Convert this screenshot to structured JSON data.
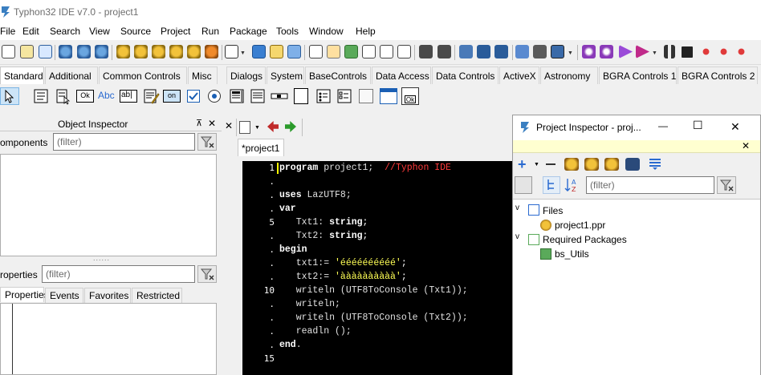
{
  "window": {
    "title": "Typhon32 IDE v7.0 - project1"
  },
  "menu": [
    "File",
    "Edit",
    "Search",
    "View",
    "Source",
    "Project",
    "Run",
    "Package",
    "Tools",
    "Window",
    "Help"
  ],
  "palette_tabs": [
    "Standard",
    "Additional",
    "Common Controls",
    "Misc",
    "Dialogs",
    "System",
    "BaseControls",
    "Data Access",
    "Data Controls",
    "ActiveX",
    "Astronomy",
    "BGRA Controls 1",
    "BGRA Controls 2"
  ],
  "palette": {
    "ok_label": "Ok",
    "abc_label": "Abc",
    "edit_label": "ab|",
    "on_label": "on",
    "ok2_label": "Ok"
  },
  "object_inspector": {
    "title": "Object Inspector",
    "pin": "⊼",
    "close": "✕",
    "components_label": "omponents",
    "components_filter": "(filter)",
    "grip": "......",
    "properties_label": "roperties",
    "properties_filter": "(filter)",
    "tabs": [
      "Properties",
      "Events",
      "Favorites",
      "Restricted"
    ]
  },
  "editor": {
    "tab": "*project1",
    "close_icon": "✕",
    "line_markers": [
      "1",
      ".",
      ".",
      ".",
      "5",
      ".",
      ".",
      ".",
      ".",
      "10",
      ".",
      ".",
      ".",
      ".",
      "15"
    ],
    "lines": [
      [
        {
          "t": "program",
          "c": "kw"
        },
        {
          "t": " project1;  ",
          "c": ""
        },
        {
          "t": "//Typhon IDE",
          "c": "cmt"
        }
      ],
      [],
      [
        {
          "t": "uses",
          "c": "kw"
        },
        {
          "t": " LazUTF8;",
          "c": ""
        }
      ],
      [
        {
          "t": "var",
          "c": "kw"
        }
      ],
      [
        {
          "t": "   Txt1: ",
          "c": ""
        },
        {
          "t": "string",
          "c": "kw"
        },
        {
          "t": ";",
          "c": "punc"
        }
      ],
      [
        {
          "t": "   Txt2: ",
          "c": ""
        },
        {
          "t": "string",
          "c": "kw"
        },
        {
          "t": ";",
          "c": "punc"
        }
      ],
      [
        {
          "t": "begin",
          "c": "kw"
        }
      ],
      [
        {
          "t": "   txt1:= ",
          "c": ""
        },
        {
          "t": "'éééééééééé'",
          "c": "str"
        },
        {
          "t": ";",
          "c": "punc"
        }
      ],
      [
        {
          "t": "   txt2:= ",
          "c": ""
        },
        {
          "t": "'àààààààààà'",
          "c": "str"
        },
        {
          "t": ";",
          "c": "punc"
        }
      ],
      [
        {
          "t": "   writeln (UTF8ToConsole (Txt1));",
          "c": ""
        }
      ],
      [
        {
          "t": "   writeln;",
          "c": ""
        }
      ],
      [
        {
          "t": "   writeln (UTF8ToConsole (Txt2));",
          "c": ""
        }
      ],
      [
        {
          "t": "   readln ();",
          "c": ""
        }
      ],
      [
        {
          "t": "end",
          "c": "kw"
        },
        {
          "t": ".",
          "c": ""
        }
      ],
      []
    ]
  },
  "project_inspector": {
    "title": "Project Inspector - proj...",
    "minimize": "—",
    "maximize": "☐",
    "close": "✕",
    "yellow_close": "✕",
    "filter": "(filter)",
    "tree": {
      "files": "Files",
      "file1": "project1.ppr",
      "required": "Required Packages",
      "pkg1": "bs_Utils"
    }
  },
  "colors": {
    "editor_bg": "#000000",
    "string": "#ffff55",
    "comment": "#ff3a3a",
    "keyword": "#ffffff"
  }
}
